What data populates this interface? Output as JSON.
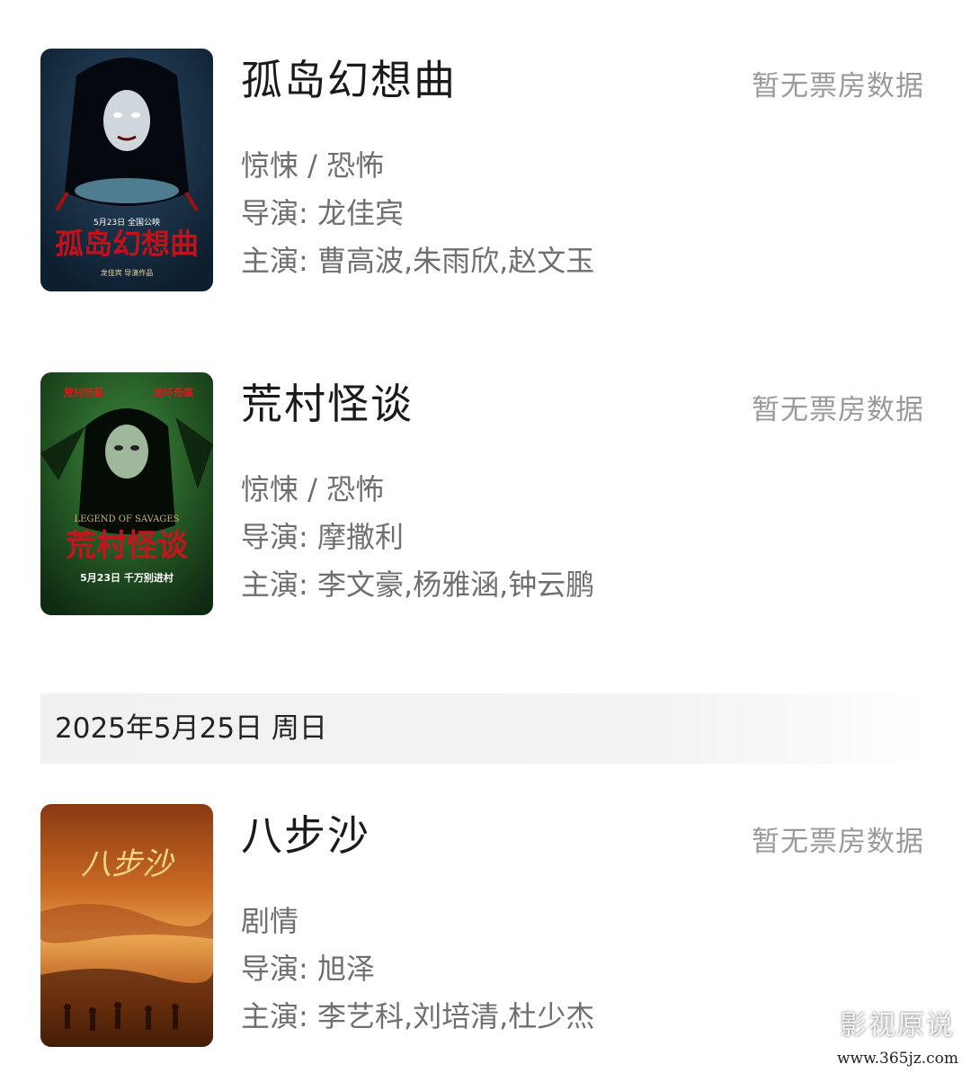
{
  "movies": [
    {
      "title": "孤岛幻想曲",
      "box_office": "暂无票房数据",
      "genre": "惊悚 / 恐怖",
      "director": "导演: 龙佳宾",
      "cast": "主演: 曹高波,朱雨欣,赵文玉",
      "poster": {
        "overlay_title": "孤岛幻想曲",
        "release_note": "5月23日 全国公映",
        "credit": "龙佳宾 导演作品",
        "colors": [
          "#0d1e2e",
          "#2b4a66",
          "#b3101a"
        ]
      }
    },
    {
      "title": "荒村怪谈",
      "box_office": "暂无票房数据",
      "genre": "惊悚 / 恐怖",
      "director": "导演: 摩撒利",
      "cast": "主演: 李文豪,杨雅涵,钟云鹏",
      "poster": {
        "tagline_left": "荒村野墓",
        "tagline_right": "迷环奇案",
        "english_title": "LEGEND OF SAVAGES",
        "overlay_title": "荒村怪谈",
        "release_note": "5月23日 千万别进村",
        "colors": [
          "#0f2a12",
          "#3c8a3a",
          "#c2161c"
        ]
      }
    },
    {
      "title": "八步沙",
      "box_office": "暂无票房数据",
      "genre": "剧情",
      "director": "导演: 旭泽",
      "cast": "主演: 李艺科,刘培清,杜少杰",
      "poster": {
        "overlay_title": "八步沙",
        "colors": [
          "#3a1806",
          "#c96a22",
          "#e9a450"
        ]
      }
    }
  ],
  "date_header": "2025年5月25日  周日",
  "watermark": {
    "text": "影视原说",
    "url": "www.365jz.com"
  }
}
